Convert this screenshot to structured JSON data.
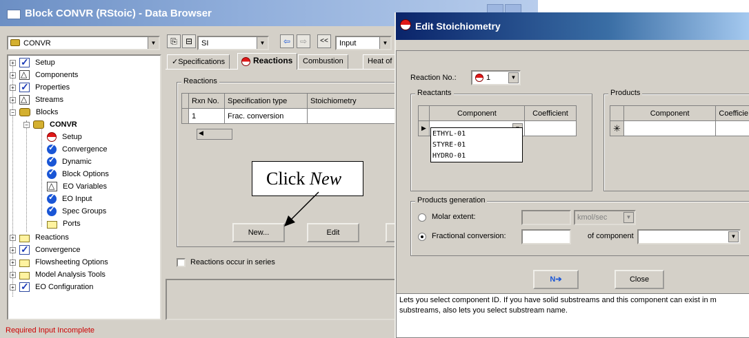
{
  "main_window": {
    "title": "Block CONVR (RStoic) - Data Browser",
    "toolbar": {
      "block_combo": "CONVR",
      "units_combo": "SI",
      "nav_back": "<<",
      "input_combo": "Input"
    },
    "tree": {
      "items": [
        {
          "label": "Setup",
          "icon": "check-icon"
        },
        {
          "label": "Components",
          "icon": "triangle-icon"
        },
        {
          "label": "Properties",
          "icon": "check-icon"
        },
        {
          "label": "Streams",
          "icon": "triangle-icon"
        },
        {
          "label": "Blocks",
          "icon": "folder-icon"
        },
        {
          "label": "CONVR",
          "icon": "block-icon"
        },
        {
          "label": "Setup",
          "icon": "red-half-icon"
        },
        {
          "label": "Convergence",
          "icon": "blue-check-icon"
        },
        {
          "label": "Dynamic",
          "icon": "blue-check-icon"
        },
        {
          "label": "Block Options",
          "icon": "blue-check-icon"
        },
        {
          "label": "EO Variables",
          "icon": "triangle-icon"
        },
        {
          "label": "EO Input",
          "icon": "blue-check-icon"
        },
        {
          "label": "Spec Groups",
          "icon": "blue-check-icon"
        },
        {
          "label": "Ports",
          "icon": "folder-icon"
        },
        {
          "label": "Reactions",
          "icon": "folder-icon"
        },
        {
          "label": "Convergence",
          "icon": "check-icon"
        },
        {
          "label": "Flowsheeting Options",
          "icon": "folder-icon"
        },
        {
          "label": "Model Analysis Tools",
          "icon": "folder-icon"
        },
        {
          "label": "EO Configuration",
          "icon": "check-icon"
        }
      ]
    },
    "status": "Required Input Incomplete",
    "status_color": "#cc0000",
    "tabs": [
      {
        "label": "✓Specifications"
      },
      {
        "label": "Reactions"
      },
      {
        "label": "Combustion"
      },
      {
        "label": "Heat of"
      }
    ],
    "reactions_group": {
      "title": "Reactions",
      "columns": [
        "Rxn No.",
        "Specification type",
        "Stoichiometry"
      ],
      "rows": [
        {
          "rxn_no": "1",
          "spec_type": "Frac. conversion",
          "stoich": ""
        }
      ]
    },
    "buttons": {
      "new": "New...",
      "edit": "Edit"
    },
    "series_checkbox_label": "Reactions occur in series",
    "callout": {
      "prefix": "Click ",
      "emphasis": "New"
    }
  },
  "dialog": {
    "title": "Edit Stoichiometry",
    "reaction_no_label": "Reaction No.:",
    "reaction_no_value": "1",
    "reactants": {
      "title": "Reactants",
      "columns": [
        "Component",
        "Coefficient"
      ],
      "dropdown_options": [
        "ETHYL-01",
        "STYRE-01",
        "HYDRO-01"
      ]
    },
    "products": {
      "title": "Products",
      "columns": [
        "Component",
        "Coefficie"
      ]
    },
    "products_generation": {
      "title": "Products generation",
      "molar_extent_label": "Molar extent:",
      "molar_units": "kmol/sec",
      "fractional_conversion_label": "Fractional conversion:",
      "of_component_label": "of component",
      "selected": "fractional"
    },
    "buttons": {
      "next": "N➔",
      "close": "Close"
    },
    "help_lines": [
      "Lets you select component ID. If you have solid substreams and this component can exist in m",
      "substreams, also lets you select substream name."
    ]
  }
}
